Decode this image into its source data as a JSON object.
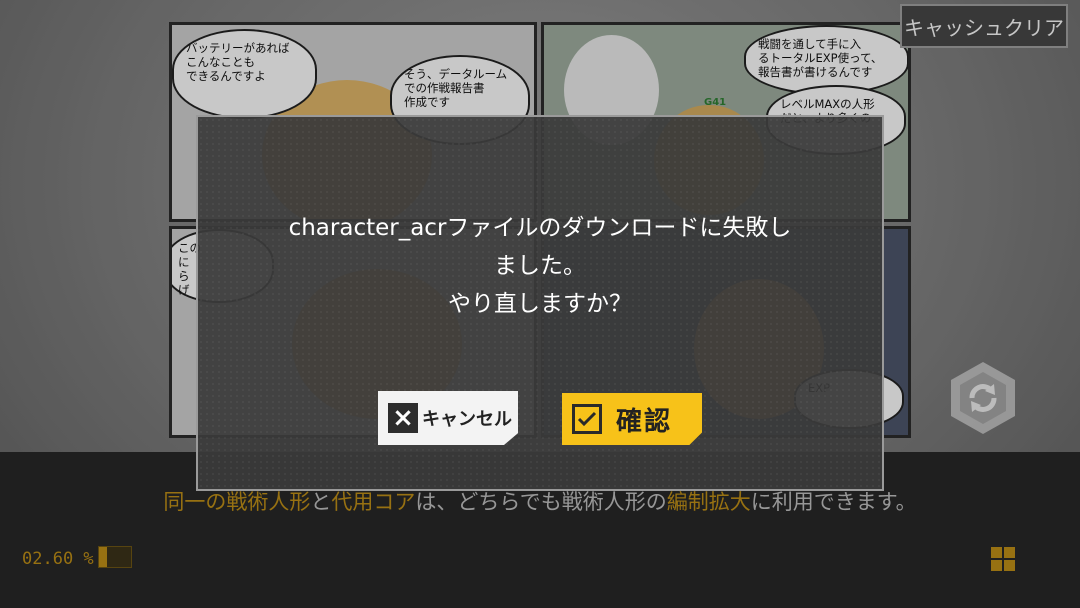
{
  "background": {
    "comic": {
      "panel1_bubble1": "バッテリーがあれば\nこんなことも\nできるんですよ",
      "panel1_bubble2": "そう、データルーム\nでの作戦報告書\n作成です",
      "panel2_bubble1": "戦闘を通して手に入\nるトータルEXP使って、\n報告書が書けるんです",
      "panel2_bubble2": "レベルMAXの人形\nだと、より多くの",
      "panel2_tag": "G41",
      "panel3_text": "この\nに\nら\nげ",
      "panel4_text": "EXP"
    }
  },
  "header": {
    "cache_clear_label": "キャッシュクリア"
  },
  "loading": {
    "tip_parts": [
      {
        "text": "同一の戦術人形",
        "highlight": true
      },
      {
        "text": "と",
        "highlight": false
      },
      {
        "text": "代用コア",
        "highlight": true
      },
      {
        "text": "は、どちらでも戦術人形の",
        "highlight": false
      },
      {
        "text": "編制拡大",
        "highlight": true
      },
      {
        "text": "に利用できます。",
        "highlight": false
      }
    ],
    "progress_text": "02.60 %",
    "progress_value": 0.026
  },
  "dialog": {
    "message_line1": "character_acrファイルのダウンロードに失敗し",
    "message_line2": "ました。",
    "message_line3": "やり直しますか？",
    "cancel_label": "キャンセル",
    "confirm_label": "確認"
  },
  "icons": {
    "refresh": "refresh-icon",
    "menu": "grid-menu-icon",
    "cancel": "close-icon",
    "confirm": "check-icon"
  },
  "colors": {
    "accent": "#b98a16",
    "confirm": "#f7c219"
  }
}
